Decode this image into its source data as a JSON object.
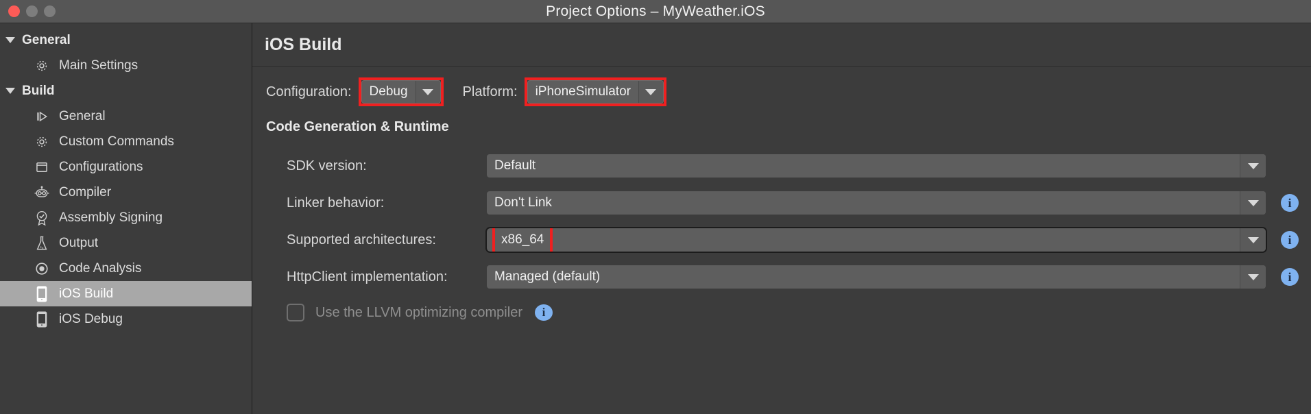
{
  "window": {
    "title": "Project Options – MyWeather.iOS",
    "traffic_lights": [
      "close-button",
      "minimize-button",
      "maximize-button"
    ]
  },
  "colors": {
    "window_bg": "#3c3c3c",
    "titlebar_bg": "#565656",
    "field_bg": "#5e5e5e",
    "selection_bg": "#a8a8a8",
    "highlight_red": "#f02020",
    "info_blue": "#7fb2f0"
  },
  "sidebar": {
    "items": [
      {
        "label": "General",
        "type": "group",
        "icon": "disclosure-triangle-down-icon",
        "selected": false
      },
      {
        "label": "Main Settings",
        "type": "child",
        "icon": "gear-icon",
        "selected": false
      },
      {
        "label": "Build",
        "type": "group",
        "icon": "disclosure-triangle-down-icon",
        "selected": false
      },
      {
        "label": "General",
        "type": "child",
        "icon": "play-bar-icon",
        "selected": false
      },
      {
        "label": "Custom Commands",
        "type": "child",
        "icon": "gear-icon",
        "selected": false
      },
      {
        "label": "Configurations",
        "type": "child",
        "icon": "window-square-icon",
        "selected": false
      },
      {
        "label": "Compiler",
        "type": "child",
        "icon": "robot-icon",
        "selected": false
      },
      {
        "label": "Assembly Signing",
        "type": "child",
        "icon": "certificate-seal-icon",
        "selected": false
      },
      {
        "label": "Output",
        "type": "child",
        "icon": "flask-icon",
        "selected": false
      },
      {
        "label": "Code Analysis",
        "type": "child",
        "icon": "radio-target-icon",
        "selected": false
      },
      {
        "label": "iOS Build",
        "type": "child",
        "icon": "phone-icon",
        "selected": true
      },
      {
        "label": "iOS Debug",
        "type": "child",
        "icon": "phone-icon",
        "selected": false
      }
    ]
  },
  "main": {
    "header_title": "iOS Build",
    "config_bar": {
      "configuration_label": "Configuration:",
      "configuration_value": "Debug",
      "configuration_highlighted": true,
      "platform_label": "Platform:",
      "platform_value": "iPhoneSimulator",
      "platform_highlighted": true
    },
    "section": {
      "title": "Code Generation & Runtime",
      "rows": [
        {
          "label": "SDK version:",
          "value": "Default",
          "highlighted": false,
          "has_info": false
        },
        {
          "label": "Linker behavior:",
          "value": "Don't Link",
          "highlighted": false,
          "has_info": true
        },
        {
          "label": "Supported architectures:",
          "value": "x86_64",
          "highlighted": true,
          "has_info": true
        },
        {
          "label": "HttpClient implementation:",
          "value": "Managed (default)",
          "highlighted": false,
          "has_info": true
        }
      ],
      "checkbox": {
        "label": "Use the LLVM optimizing compiler",
        "checked": false,
        "has_info": true
      }
    }
  }
}
